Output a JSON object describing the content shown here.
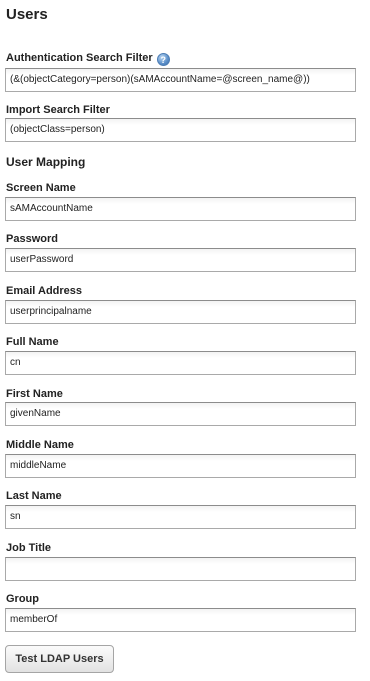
{
  "page": {
    "title": "Users"
  },
  "auth_filter": {
    "label": "Authentication Search Filter",
    "help_icon": "help-icon",
    "value": "(&(objectCategory=person)(sAMAccountName=@screen_name@))"
  },
  "import_filter": {
    "label": "Import Search Filter",
    "value": "(objectClass=person)"
  },
  "user_mapping": {
    "heading": "User Mapping",
    "fields": [
      {
        "label": "Screen Name",
        "value": "sAMAccountName"
      },
      {
        "label": "Password",
        "value": "userPassword"
      },
      {
        "label": "Email Address",
        "value": "userprincipalname"
      },
      {
        "label": "Full Name",
        "value": "cn"
      },
      {
        "label": "First Name",
        "value": "givenName"
      },
      {
        "label": "Middle Name",
        "value": "middleName"
      },
      {
        "label": "Last Name",
        "value": "sn"
      },
      {
        "label": "Job Title",
        "value": ""
      },
      {
        "label": "Group",
        "value": "memberOf"
      }
    ]
  },
  "actions": {
    "test_button": "Test LDAP Users"
  }
}
